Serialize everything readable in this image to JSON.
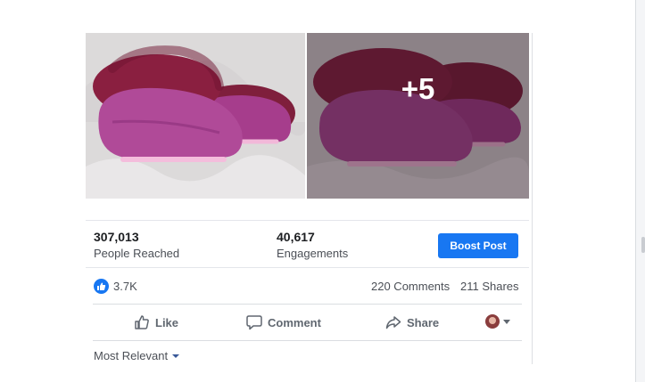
{
  "photos": {
    "more_count": "+5",
    "icons": [
      "slipper-photo",
      "slipper-photo-overlay"
    ]
  },
  "stats": {
    "reach_value": "307,013",
    "reach_label": "People Reached",
    "engagements_value": "40,617",
    "engagements_label": "Engagements",
    "boost_label": "Boost Post"
  },
  "reactions": {
    "like_count": "3.7K",
    "comments": "220 Comments",
    "shares": "211 Shares"
  },
  "actions": {
    "like": "Like",
    "comment": "Comment",
    "share": "Share"
  },
  "sort": {
    "label": "Most Relevant"
  },
  "colors": {
    "accent": "#1877f2",
    "slipper_primary": "#a13a8a",
    "slipper_dark": "#6b2848"
  }
}
